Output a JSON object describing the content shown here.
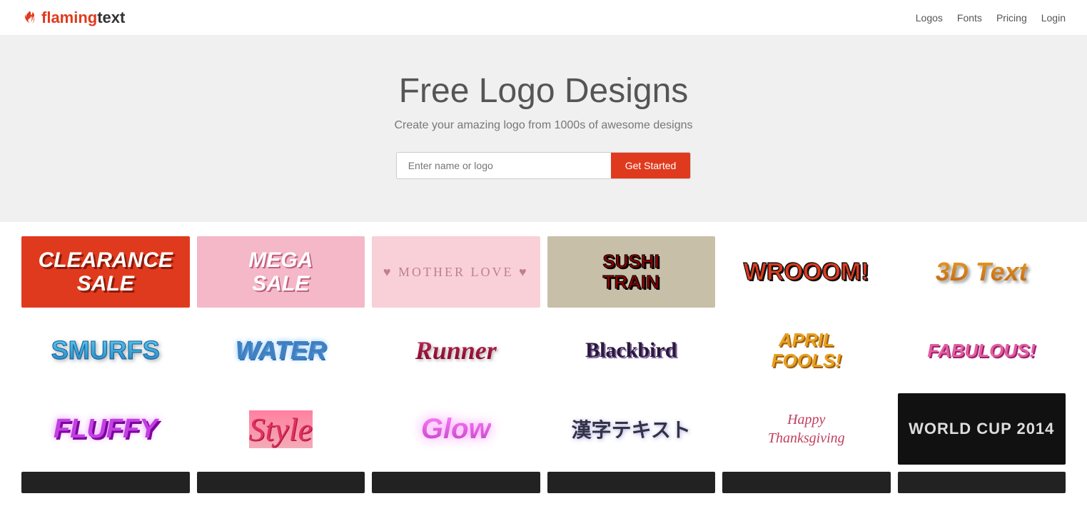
{
  "header": {
    "brand": "flamingtext",
    "brand_flaming": "flaming",
    "brand_text": "text",
    "nav": [
      {
        "label": "Logos",
        "href": "#"
      },
      {
        "label": "Fonts",
        "href": "#"
      },
      {
        "label": "Pricing",
        "href": "#"
      },
      {
        "label": "Login",
        "href": "#"
      }
    ]
  },
  "hero": {
    "title": "Free Logo Designs",
    "subtitle": "Create your amazing logo from 1000s of awesome designs",
    "search_placeholder": "Enter name or logo",
    "cta_button": "Get Started"
  },
  "gallery": {
    "rows": [
      [
        {
          "id": "clearance",
          "text": "CLEARANCE SALE",
          "bg": "#e03a1e"
        },
        {
          "id": "mega",
          "text": "MEGA SALE",
          "bg": "#f4b8c8"
        },
        {
          "id": "mother",
          "text": "♥ MOTHER LOVE ♥",
          "bg": "#f9d0d8"
        },
        {
          "id": "sushi",
          "text": "SUSHI TRAIN",
          "bg": "#c8bfa8"
        },
        {
          "id": "wrooom",
          "text": "WROOOM!",
          "bg": "#ffffff"
        },
        {
          "id": "3dtext",
          "text": "3D Text",
          "bg": "#ffffff"
        }
      ],
      [
        {
          "id": "smurfs",
          "text": "SMURFS",
          "bg": "#ffffff"
        },
        {
          "id": "water",
          "text": "WATER",
          "bg": "#ffffff"
        },
        {
          "id": "runner",
          "text": "Runner",
          "bg": "#ffffff"
        },
        {
          "id": "blackbird",
          "text": "Blackbird",
          "bg": "#ffffff"
        },
        {
          "id": "april",
          "text": "APRIL FOOLS!",
          "bg": "#ffffff"
        },
        {
          "id": "fabulous",
          "text": "FABULOUS!",
          "bg": "#ffffff"
        }
      ],
      [
        {
          "id": "fluffy",
          "text": "FLUFFY",
          "bg": "#ffffff"
        },
        {
          "id": "style",
          "text": "Style",
          "bg": "#ffffff"
        },
        {
          "id": "glow",
          "text": "Glow",
          "bg": "#ffffff"
        },
        {
          "id": "kanji",
          "text": "漢字テキスト",
          "bg": "#ffffff"
        },
        {
          "id": "thanksgiving",
          "text": "Happy\nThanksgiving",
          "bg": "#ffffff"
        },
        {
          "id": "worldcup",
          "text": "WORLD CUP 2014",
          "bg": "#111111"
        }
      ]
    ]
  }
}
